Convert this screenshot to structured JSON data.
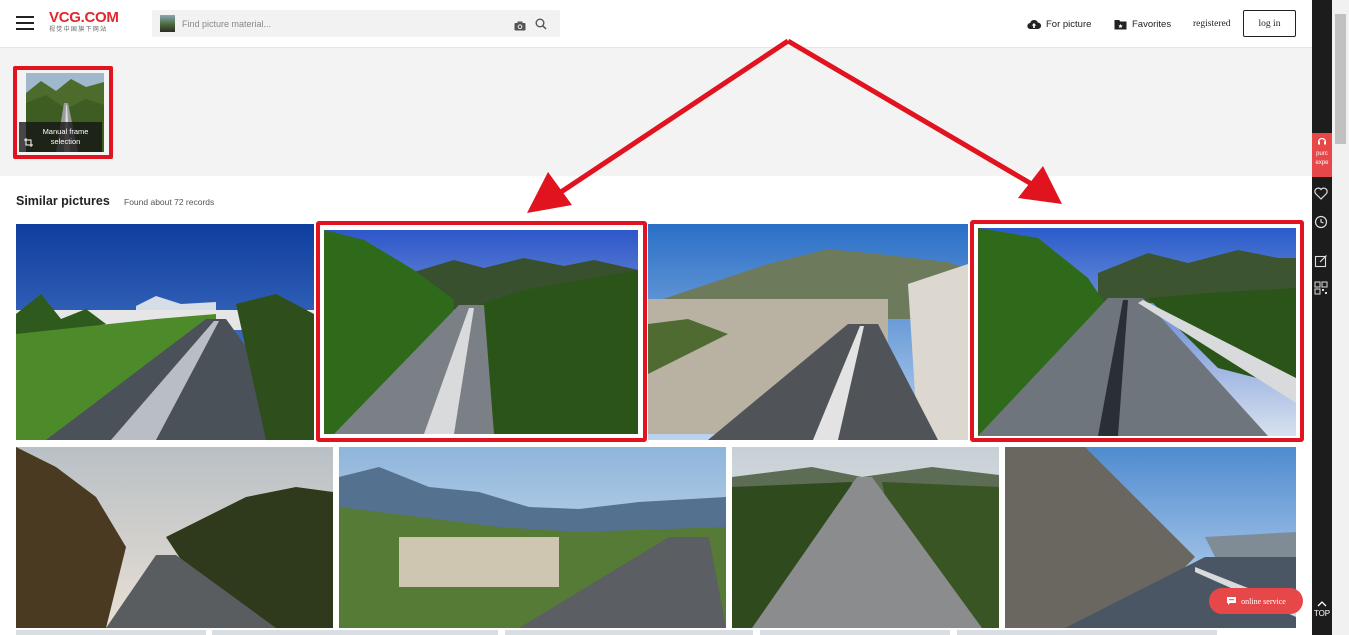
{
  "header": {
    "logo_text": "VCG.COM",
    "logo_subtitle": "视觉中国旗下网站",
    "search_placeholder": "Find picture material...",
    "nav": {
      "for_picture": "For picture",
      "favorites": "Favorites",
      "registered": "registered",
      "login": "log in"
    }
  },
  "frame_selection": {
    "label": "Manual frame selection"
  },
  "results": {
    "title": "Similar pictures",
    "count_text": "Found about 72 records"
  },
  "sidebar": {
    "red_text": "purc expe",
    "top_label": "TOP"
  },
  "online_service": "online service",
  "colors": {
    "brand_red": "#e4262d",
    "highlight_red": "#e1131f",
    "service_red": "#e8474a"
  },
  "icons": [
    "hamburger-icon",
    "camera-icon",
    "search-icon",
    "cloud-upload-icon",
    "folder-icon",
    "crop-icon",
    "headset-icon",
    "heart-icon",
    "history-icon",
    "edit-icon",
    "qrcode-icon",
    "chat-icon",
    "arrow-up-icon"
  ]
}
